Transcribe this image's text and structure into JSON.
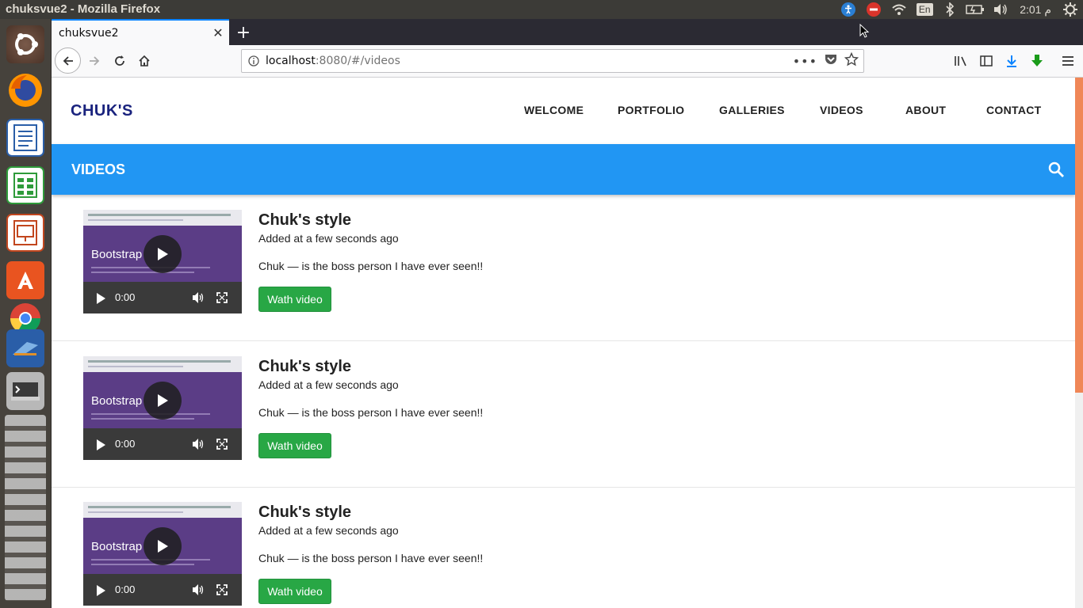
{
  "os_panel": {
    "window_title": "chuksvue2 - Mozilla Firefox",
    "keyboard_layout": "En",
    "clock": "2:01 م"
  },
  "launcher": {
    "items": [
      "ubuntu-dash-icon",
      "firefox-icon",
      "writer-icon",
      "calc-icon",
      "impress-icon",
      "software-center-icon",
      "chrome-icon",
      "app-icon",
      "terminal-icon"
    ]
  },
  "browser": {
    "tab_title": "chuksvue2",
    "url_host": "localhost",
    "url_rest": ":8080/#/videos"
  },
  "site": {
    "brand": "CHUK'S",
    "nav": [
      "WELCOME",
      "PORTFOLIO",
      "GALLERIES",
      "VIDEOS",
      "ABOUT",
      "CONTACT"
    ],
    "toolbar_title": "VIDEOS"
  },
  "videos": [
    {
      "title": "Chuk's style",
      "added": "Added at a few seconds ago",
      "description": "Chuk — is the boss person I have ever seen!!",
      "button": "Wath video",
      "thumb_text": "Bootstrap",
      "time": "0:00"
    },
    {
      "title": "Chuk's style",
      "added": "Added at a few seconds ago",
      "description": "Chuk — is the boss person I have ever seen!!",
      "button": "Wath video",
      "thumb_text": "Bootstrap",
      "time": "0:00"
    },
    {
      "title": "Chuk's style",
      "added": "Added at a few seconds ago",
      "description": "Chuk — is the boss person I have ever seen!!",
      "button": "Wath video",
      "thumb_text": "Bootstrap",
      "time": "0:00"
    }
  ],
  "colors": {
    "toolbar": "#2196f3",
    "brand": "#1a237e",
    "button": "#28a745",
    "scroll_thumb": "#f08757"
  }
}
